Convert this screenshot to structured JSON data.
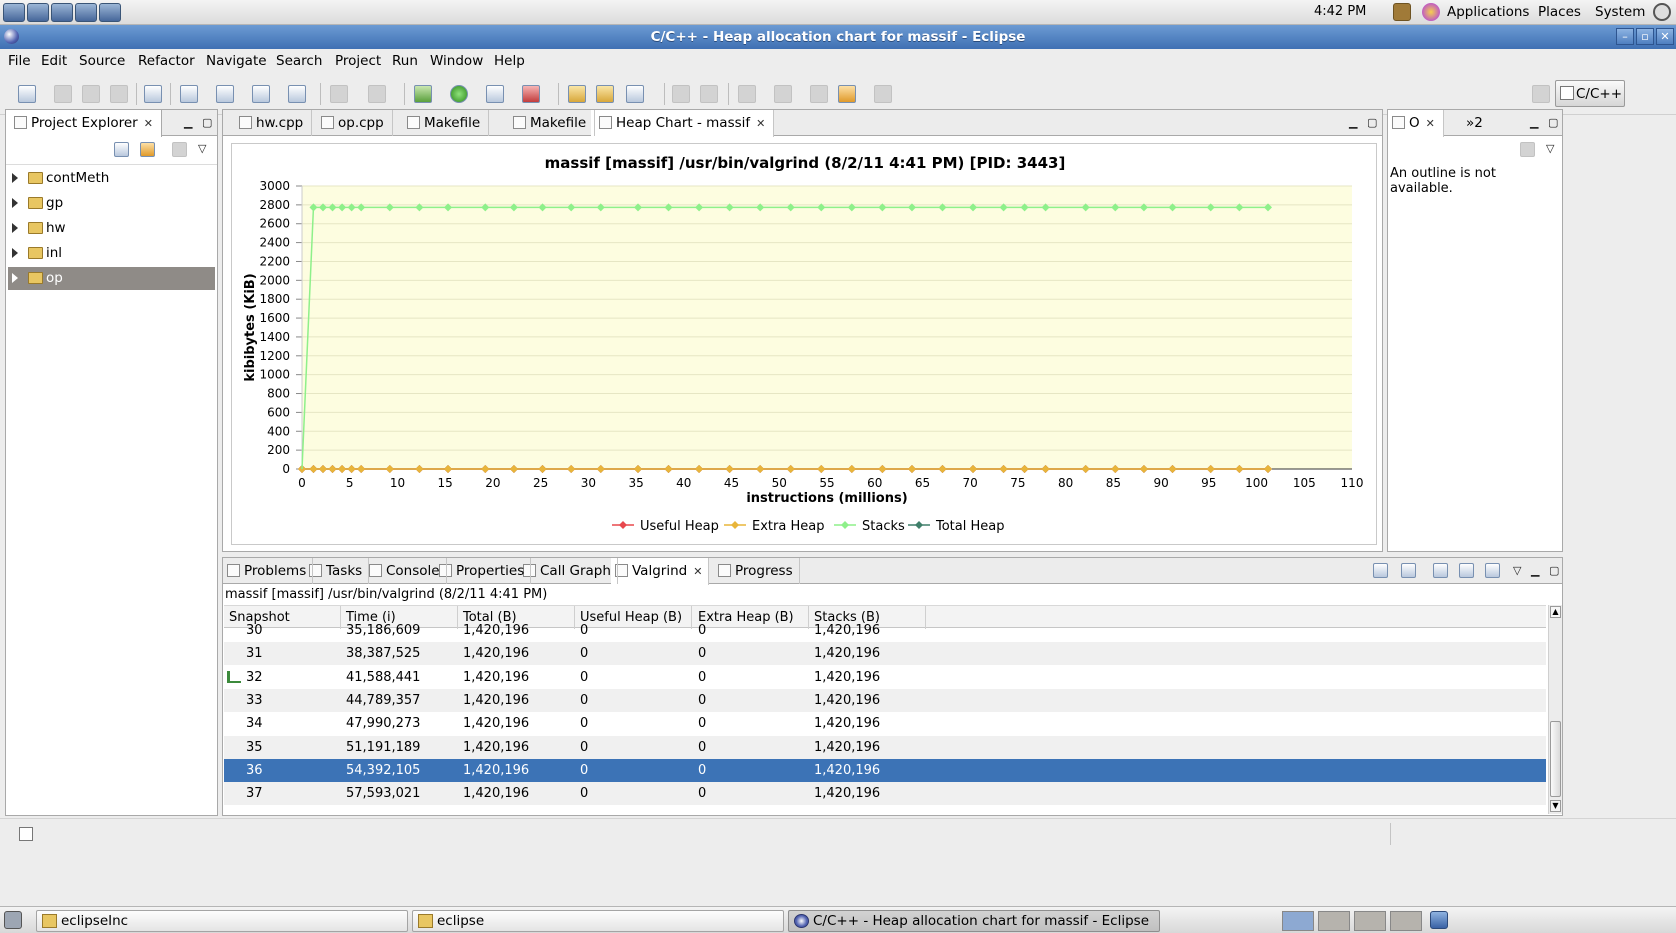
{
  "top_panel": {
    "clock": "4:42 PM",
    "menus": [
      "Applications",
      "Places",
      "System"
    ]
  },
  "window": {
    "title": "C/C++ - Heap allocation chart for massif - Eclipse"
  },
  "menubar": [
    "File",
    "Edit",
    "Source",
    "Refactor",
    "Navigate",
    "Search",
    "Project",
    "Run",
    "Window",
    "Help"
  ],
  "perspective": {
    "label": "C/C++"
  },
  "explorer": {
    "tab_label": "Project Explorer",
    "items": [
      {
        "label": "contMeth"
      },
      {
        "label": "gp"
      },
      {
        "label": "hw"
      },
      {
        "label": "inl"
      },
      {
        "label": "op"
      }
    ],
    "selected_index": 4
  },
  "editor": {
    "tabs": [
      {
        "label": "hw.cpp"
      },
      {
        "label": "op.cpp"
      },
      {
        "label": "Makefile"
      },
      {
        "label": "Makefile"
      },
      {
        "label": "Heap Chart - massif"
      }
    ],
    "active_index": 4
  },
  "chart_data": {
    "type": "line",
    "title": "massif [massif] /usr/bin/valgrind (8/2/11 4:41 PM) [PID: 3443]",
    "xlabel": "instructions (millions)",
    "ylabel": "kibibytes (KiB)",
    "xlim": [
      0,
      110
    ],
    "ylim": [
      0,
      3000
    ],
    "x_ticks": [
      0,
      5,
      10,
      15,
      20,
      25,
      30,
      35,
      40,
      45,
      50,
      55,
      60,
      65,
      70,
      75,
      80,
      85,
      90,
      95,
      100,
      105,
      110
    ],
    "y_ticks": [
      0,
      200,
      400,
      600,
      800,
      1000,
      1200,
      1400,
      1600,
      1800,
      2000,
      2200,
      2400,
      2600,
      2800,
      3000
    ],
    "grid": true,
    "legend": "bottom",
    "x": [
      0,
      1.2,
      2.2,
      3.2,
      4.2,
      5.2,
      6.2,
      9.2,
      12.3,
      15.3,
      19.2,
      22.2,
      25.2,
      28.2,
      31.3,
      35.2,
      38.4,
      41.6,
      44.8,
      48.0,
      51.2,
      54.4,
      57.6,
      60.8,
      63.9,
      67.1,
      70.3,
      73.5,
      75.7,
      77.9,
      82.1,
      85.2,
      88.2,
      91.2,
      95.2,
      98.2,
      101.2
    ],
    "series": [
      {
        "name": "Useful Heap",
        "color": "#e8484d",
        "values": [
          0,
          0,
          0,
          0,
          0,
          0,
          0,
          0,
          0,
          0,
          0,
          0,
          0,
          0,
          0,
          0,
          0,
          0,
          0,
          0,
          0,
          0,
          0,
          0,
          0,
          0,
          0,
          0,
          0,
          0,
          0,
          0,
          0,
          0,
          0,
          0,
          0
        ]
      },
      {
        "name": "Extra Heap",
        "color": "#e8b53a",
        "values": [
          0,
          0,
          0,
          0,
          0,
          0,
          0,
          0,
          0,
          0,
          0,
          0,
          0,
          0,
          0,
          0,
          0,
          0,
          0,
          0,
          0,
          0,
          0,
          0,
          0,
          0,
          0,
          0,
          0,
          0,
          0,
          0,
          0,
          0,
          0,
          0,
          0
        ]
      },
      {
        "name": "Stacks",
        "color": "#8ef08a",
        "values": [
          0,
          2773,
          2773,
          2773,
          2773,
          2773,
          2773,
          2773,
          2773,
          2773,
          2773,
          2773,
          2773,
          2773,
          2773,
          2773,
          2773,
          2773,
          2773,
          2773,
          2773,
          2773,
          2773,
          2773,
          2773,
          2773,
          2773,
          2773,
          2773,
          2773,
          2773,
          2773,
          2773,
          2773,
          2773,
          2773,
          2773
        ]
      },
      {
        "name": "Total Heap",
        "color": "#3f7f6a",
        "values": [
          0,
          0,
          0,
          0,
          0,
          0,
          0,
          0,
          0,
          0,
          0,
          0,
          0,
          0,
          0,
          0,
          0,
          0,
          0,
          0,
          0,
          0,
          0,
          0,
          0,
          0,
          0,
          0,
          0,
          0,
          0,
          0,
          0,
          0,
          0,
          0,
          0
        ]
      }
    ]
  },
  "outline": {
    "tab_label": "O",
    "overflow_label": "»2",
    "message": "An outline is not available."
  },
  "bottom": {
    "tabs": [
      {
        "label": "Problems"
      },
      {
        "label": "Tasks"
      },
      {
        "label": "Console"
      },
      {
        "label": "Properties"
      },
      {
        "label": "Call Graph"
      },
      {
        "label": "Valgrind"
      },
      {
        "label": "Progress"
      }
    ],
    "active_index": 5,
    "run_label": "massif [massif] /usr/bin/valgrind (8/2/11 4:41 PM)",
    "columns": [
      "Snapshot",
      "Time (i)",
      "Total (B)",
      "Useful Heap (B)",
      "Extra Heap (B)",
      "Stacks (B)"
    ],
    "rows": [
      [
        "30",
        "35,186,609",
        "1,420,196",
        "0",
        "0",
        "1,420,196"
      ],
      [
        "31",
        "38,387,525",
        "1,420,196",
        "0",
        "0",
        "1,420,196"
      ],
      [
        "32",
        "41,588,441",
        "1,420,196",
        "0",
        "0",
        "1,420,196"
      ],
      [
        "33",
        "44,789,357",
        "1,420,196",
        "0",
        "0",
        "1,420,196"
      ],
      [
        "34",
        "47,990,273",
        "1,420,196",
        "0",
        "0",
        "1,420,196"
      ],
      [
        "35",
        "51,191,189",
        "1,420,196",
        "0",
        "0",
        "1,420,196"
      ],
      [
        "36",
        "54,392,105",
        "1,420,196",
        "0",
        "0",
        "1,420,196"
      ],
      [
        "37",
        "57,593,021",
        "1,420,196",
        "0",
        "0",
        "1,420,196"
      ]
    ],
    "selected_row": 6,
    "detailed_row": 2
  },
  "taskbar": {
    "tasks": [
      {
        "label": "eclipseInc"
      },
      {
        "label": "eclipse"
      },
      {
        "label": "C/C++ - Heap allocation chart for massif - Eclipse"
      }
    ]
  }
}
